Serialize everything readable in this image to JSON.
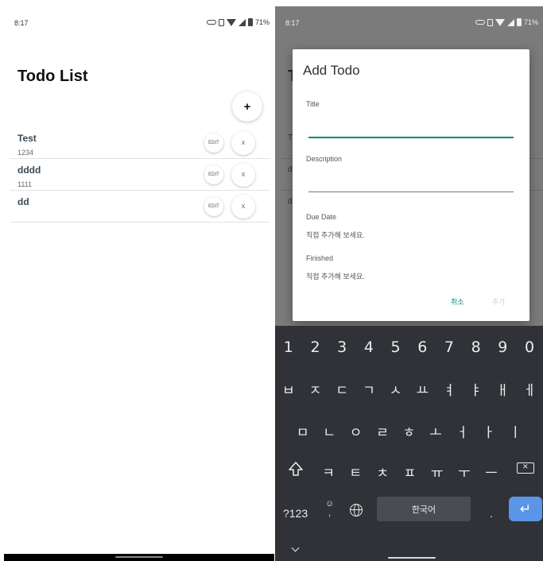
{
  "left_screen": {
    "status": {
      "time": "8:17",
      "battery": "71%"
    },
    "title": "Todo List",
    "add_button": "+",
    "todos": [
      {
        "title": "Test",
        "description": "1234",
        "edit": "EDIT",
        "delete": "X"
      },
      {
        "title": "dddd",
        "description": "1111",
        "edit": "EDIT",
        "delete": "X"
      },
      {
        "title": "dd",
        "description": "",
        "edit": "EDIT",
        "delete": "X"
      }
    ]
  },
  "right_screen": {
    "status": {
      "time": "8:17",
      "battery": "71%"
    },
    "dialog": {
      "title": "Add Todo",
      "title_label": "Title",
      "title_value": "",
      "description_label": "Description",
      "description_value": "",
      "due_date_label": "Due Date",
      "due_date_hint": "직접 추가해 보세요.",
      "finished_label": "Finished",
      "finished_hint": "직접 추가해 보세요.",
      "cancel": "취소",
      "add": "추가"
    },
    "keyboard": {
      "numbers": [
        "1",
        "2",
        "3",
        "4",
        "5",
        "6",
        "7",
        "8",
        "9",
        "0"
      ],
      "row1": [
        "ㅂ",
        "ㅈ",
        "ㄷ",
        "ㄱ",
        "ㅅ",
        "ㅛ",
        "ㅕ",
        "ㅑ",
        "ㅐ",
        "ㅔ"
      ],
      "row2": [
        "ㅁ",
        "ㄴ",
        "ㅇ",
        "ㄹ",
        "ㅎ",
        "ㅗ",
        "ㅓ",
        "ㅏ",
        "ㅣ"
      ],
      "row3": [
        "ㅋ",
        "ㅌ",
        "ㅊ",
        "ㅍ",
        "ㅠ",
        "ㅜ",
        "ㅡ"
      ],
      "symbols_key": "?123",
      "comma_key": ",",
      "emoji_glyph": "☺",
      "space_label": "한국어",
      "period_key": ".",
      "enter_glyph": "↵"
    }
  }
}
